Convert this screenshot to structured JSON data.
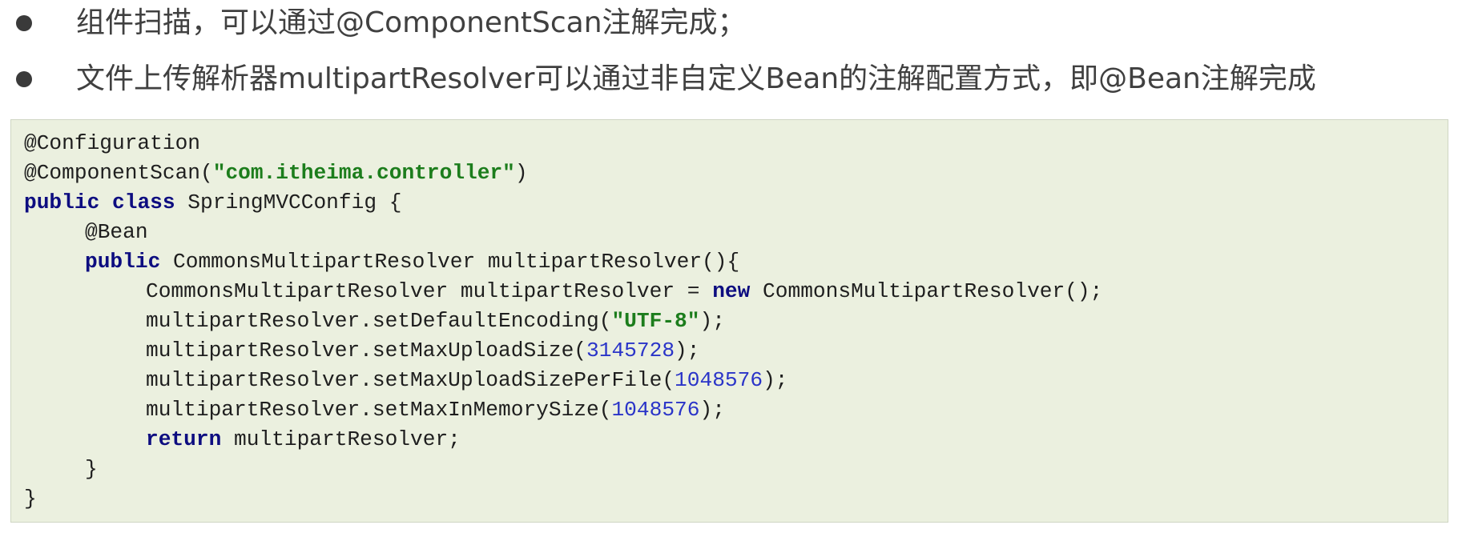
{
  "bullets": [
    "组件扫描，可以通过@ComponentScan注解完成；",
    "文件上传解析器multipartResolver可以通过非自定义Bean的注解配置方式，即@Bean注解完成"
  ],
  "code": {
    "l1": "@Configuration",
    "l2_pre": "@ComponentScan(",
    "l2_str": "\"com.itheima.controller\"",
    "l2_post": ")",
    "l3_kw1": "public",
    "l3_kw2": "class",
    "l3_rest": " SpringMVCConfig {",
    "l4": "@Bean",
    "l5_kw": "public",
    "l5_rest": " CommonsMultipartResolver multipartResolver(){",
    "l6_pre": "CommonsMultipartResolver multipartResolver = ",
    "l6_kw": "new",
    "l6_post": " CommonsMultipartResolver();",
    "l7_pre": "multipartResolver.setDefaultEncoding(",
    "l7_str": "\"UTF-8\"",
    "l7_post": ");",
    "l8_pre": "multipartResolver.setMaxUploadSize(",
    "l8_num": "3145728",
    "l8_post": ");",
    "l9_pre": "multipartResolver.setMaxUploadSizePerFile(",
    "l9_num": "1048576",
    "l9_post": ");",
    "l10_pre": "multipartResolver.setMaxInMemorySize(",
    "l10_num": "1048576",
    "l10_post": ");",
    "l11_kw": "return",
    "l11_rest": " multipartResolver;",
    "l12": "}",
    "l13": "}"
  }
}
